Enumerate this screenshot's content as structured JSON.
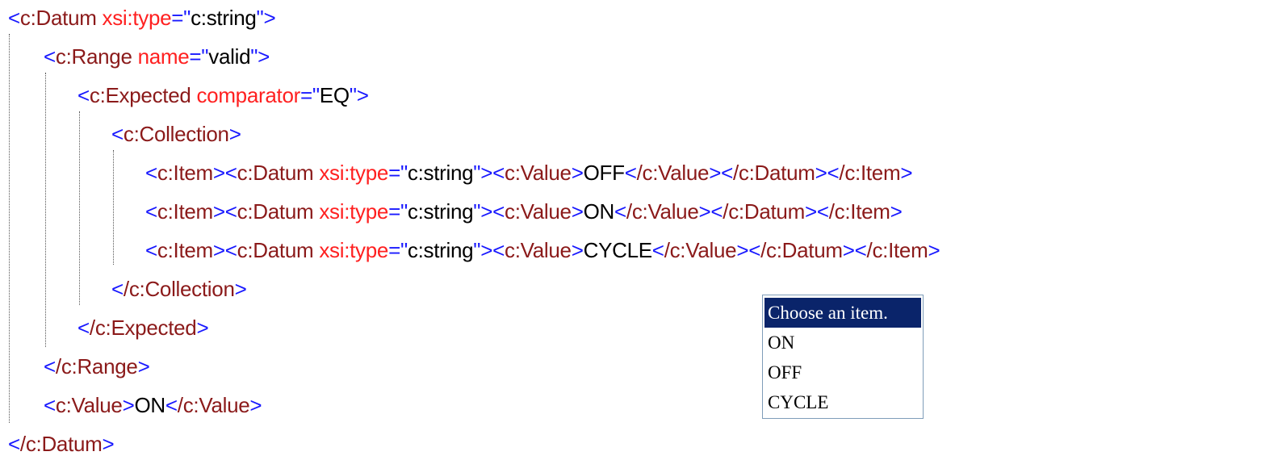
{
  "xml": {
    "datum_open": {
      "tag": "c:Datum",
      "attr": "xsi:type",
      "value": "c:string"
    },
    "range_open": {
      "tag": "c:Range",
      "attr": "name",
      "value": "valid"
    },
    "expected_open": {
      "tag": "c:Expected",
      "attr": "comparator",
      "value": "EQ"
    },
    "collection_open": {
      "tag": "c:Collection"
    },
    "items": [
      {
        "item_tag": "c:Item",
        "datum_tag": "c:Datum",
        "attr": "xsi:type",
        "attr_value": "c:string",
        "value_tag": "c:Value",
        "text": "OFF",
        "value_close": "/c:Value",
        "datum_close": "/c:Datum",
        "item_close": "/c:Item"
      },
      {
        "item_tag": "c:Item",
        "datum_tag": "c:Datum",
        "attr": "xsi:type",
        "attr_value": "c:string",
        "value_tag": "c:Value",
        "text": "ON",
        "value_close": "/c:Value",
        "datum_close": "/c:Datum",
        "item_close": "/c:Item"
      },
      {
        "item_tag": "c:Item",
        "datum_tag": "c:Datum",
        "attr": "xsi:type",
        "attr_value": "c:string",
        "value_tag": "c:Value",
        "text": "CYCLE",
        "value_close": "/c:Value",
        "datum_close": "/c:Datum",
        "item_close": "/c:Item"
      }
    ],
    "collection_close": {
      "tag": "/c:Collection"
    },
    "expected_close": {
      "tag": "/c:Expected"
    },
    "range_close": {
      "tag": "/c:Range"
    },
    "value_line": {
      "open": "c:Value",
      "text": "ON",
      "close": "/c:Value"
    },
    "datum_close": {
      "tag": "/c:Datum"
    }
  },
  "dropdown": {
    "options": [
      "Choose an item.",
      "ON",
      "OFF",
      "CYCLE"
    ],
    "selected": "Choose an item."
  },
  "colors": {
    "markup": "#1818ff",
    "element_name": "#8b1a1a",
    "attribute_name": "#ff2020",
    "selection": "#0a246a"
  }
}
